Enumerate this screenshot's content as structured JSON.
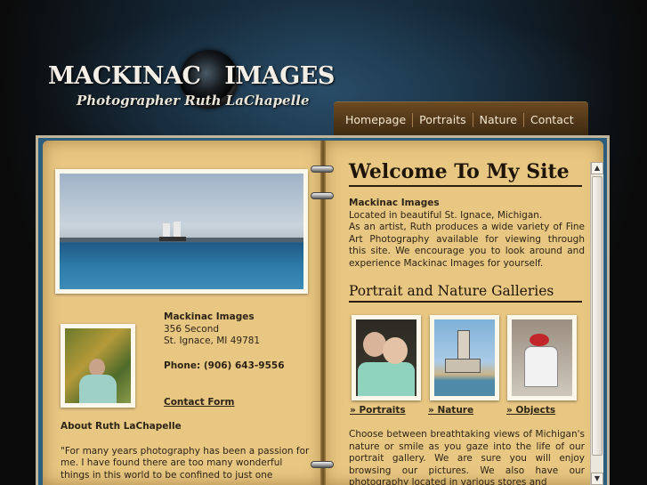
{
  "header": {
    "logo_title": "MACKINAC   IMAGES",
    "logo_subtitle": "Photographer Ruth LaChapelle"
  },
  "nav": {
    "items": [
      "Homepage",
      "Portraits",
      "Nature",
      "Contact"
    ]
  },
  "contact": {
    "name": "Mackinac Images",
    "street": "356 Second",
    "city": "St. Ignace, MI 49781",
    "phone": "Phone: (906) 643-9556",
    "form_link": "Contact Form"
  },
  "about": {
    "heading": "About Ruth LaChapelle",
    "text": "\"For many years photography has been a passion for me.  I have found there are too many wonderful things in this world to be confined to just one"
  },
  "main": {
    "welcome_title": "Welcome To My Site",
    "intro_name": "Mackinac Images",
    "intro_location": "Located in beautiful St. Ignace, Michigan.",
    "intro_text": "As an artist, Ruth produces a wide variety of Fine Art Photography available for viewing through this site.  We encourage you to look around and experience Mackinac Images for yourself.",
    "galleries_title": "Portrait and Nature Galleries",
    "gallery_links": [
      "» Portraits",
      "» Nature",
      "» Objects"
    ],
    "bottom_text": "Choose between breathtaking views of Michigan's nature or smile as you gaze into the life of our portrait gallery. We are sure you will enjoy browsing our pictures.  We also have our photography located in various stores and"
  },
  "colors": {
    "paper": "#e8c783",
    "frame": "#2a5d7e",
    "nav_bg": "#5a3d1a"
  }
}
